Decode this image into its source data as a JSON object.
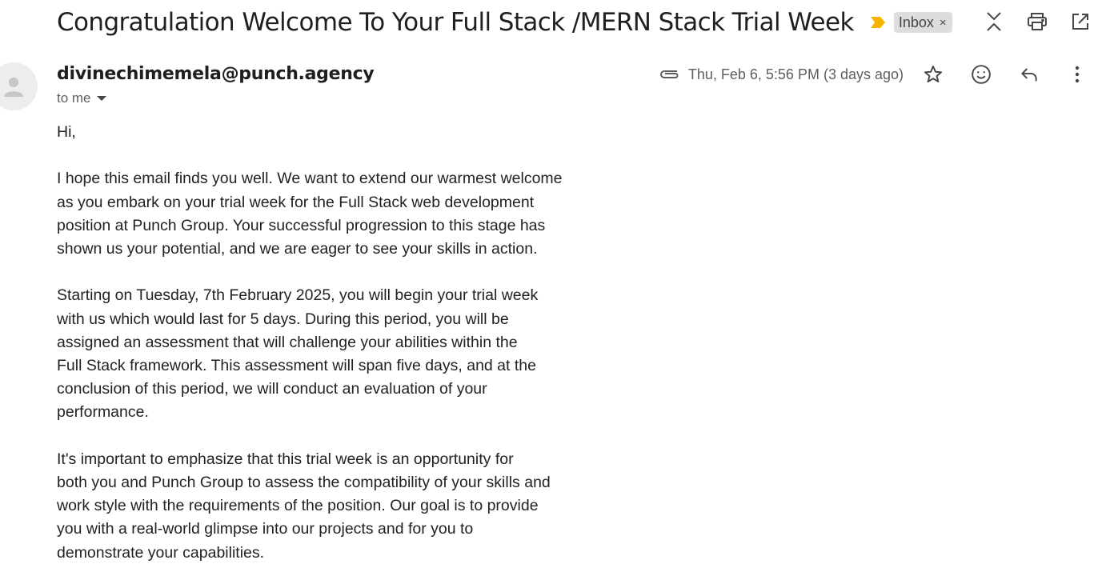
{
  "email": {
    "subject": "Congratulation Welcome To Your Full Stack /MERN Stack Trial Week",
    "label": "Inbox",
    "label_close": "×",
    "sender": "divinechimemela@punch.agency",
    "recipients": "to me",
    "date": "Thu, Feb 6, 5:56 PM (3 days ago)",
    "body": [
      "Hi,",
      "I hope this email finds you well. We want to extend our warmest welcome\nas you embark on your trial week for the Full Stack web development\nposition at Punch Group. Your successful progression to this stage has\nshown us your potential, and we are eager to see your skills in action.",
      "Starting on Tuesday, 7th February 2025, you will begin your trial week\nwith us which would last for 5 days. During this period, you will be\nassigned an assessment that will challenge your abilities within the\nFull Stack framework. This assessment will span five days, and at the\nconclusion of this period, we will conduct an evaluation of your\nperformance.",
      "It's important to emphasize that this trial week is an opportunity for\nboth you and Punch Group to assess the compatibility of your skills and\nwork style with the requirements of the position. Our goal is to provide\nyou with a real-world glimpse into our projects and for you to\ndemonstrate your capabilities."
    ]
  },
  "icons": {
    "importance": "importance-marker-icon",
    "collapse": "collapse-all-icon",
    "print": "print-icon",
    "new_window": "open-in-new-window-icon",
    "attachment": "attachment-icon",
    "star": "star-icon",
    "emoji": "add-reaction-icon",
    "reply": "reply-icon",
    "more": "more-options-icon"
  },
  "colors": {
    "importance": "#f4b400",
    "label_bg": "#dddddd",
    "text": "#202124",
    "muted": "#5e5e5e"
  }
}
